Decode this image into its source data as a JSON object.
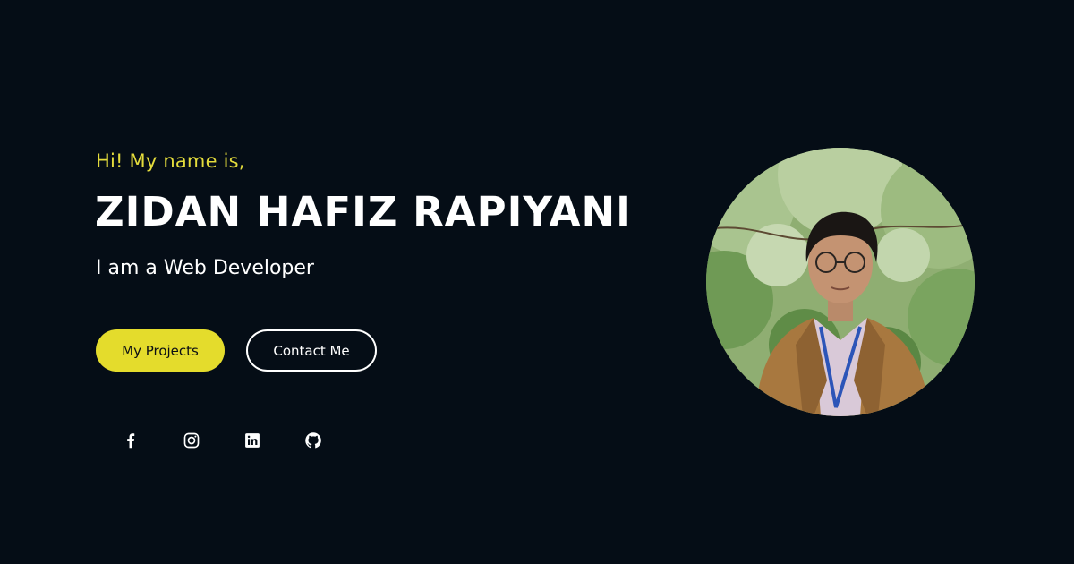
{
  "hero": {
    "greeting": "Hi! My name is,",
    "name": "ZIDAN HAFIZ RAPIYANI",
    "role": "I am a Web Developer",
    "primary_button": "My Projects",
    "secondary_button": "Contact Me"
  },
  "socials": [
    {
      "icon": "facebook-icon"
    },
    {
      "icon": "instagram-icon"
    },
    {
      "icon": "linkedin-icon"
    },
    {
      "icon": "github-icon"
    }
  ],
  "profile_photo": {
    "subject": "portrait"
  },
  "colors": {
    "background": "#050d16",
    "accent": "#e4dc2c",
    "text": "#ffffff"
  }
}
